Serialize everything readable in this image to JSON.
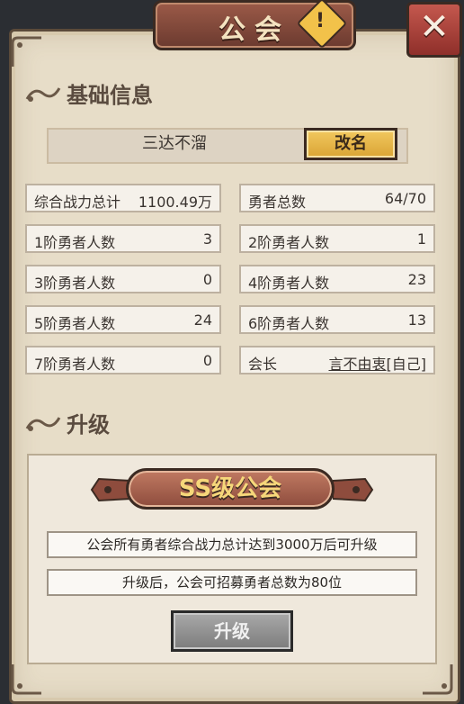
{
  "header": {
    "title": "公会",
    "warning_glyph": "!",
    "close_glyph": "✕"
  },
  "basic_info": {
    "heading": "基础信息",
    "guild_name": "三达不溜",
    "rename_label": "改名",
    "stats_left": [
      {
        "label": "综合战力总计",
        "value": "1100.49万"
      },
      {
        "label": "1阶勇者人数",
        "value": "3"
      },
      {
        "label": "3阶勇者人数",
        "value": "0"
      },
      {
        "label": "5阶勇者人数",
        "value": "24"
      },
      {
        "label": "7阶勇者人数",
        "value": "0"
      }
    ],
    "stats_right": [
      {
        "label": "勇者总数",
        "value": "64/70"
      },
      {
        "label": "2阶勇者人数",
        "value": "1"
      },
      {
        "label": "4阶勇者人数",
        "value": "23"
      },
      {
        "label": "6阶勇者人数",
        "value": "13"
      }
    ],
    "leader": {
      "label": "会长",
      "name": "言不由衷",
      "tag": "[自己]"
    }
  },
  "upgrade": {
    "heading": "升级",
    "grade": "SS级公会",
    "requirement": "公会所有勇者综合战力总计达到3000万后可升级",
    "benefit": "升级后，公会可招募勇者总数为80位",
    "button_label": "升级"
  },
  "colors": {
    "panel": "#e7ddc8",
    "title_banner": "#8b4c3e",
    "rename_button": "#e8b84a",
    "close_button": "#b04a42",
    "upgrade_button_disabled": "#8c8c8c",
    "grade_text": "#f6d77a"
  },
  "icons": [
    "warning-icon",
    "close-icon",
    "section-scroll-icon",
    "corner-ornament-icon"
  ]
}
